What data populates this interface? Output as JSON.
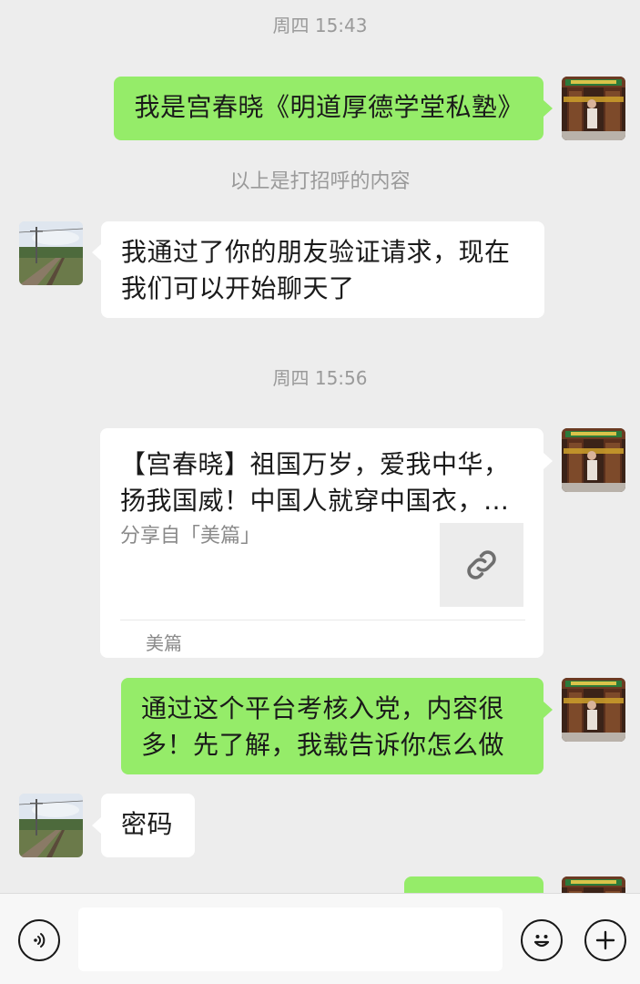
{
  "chat": {
    "messages": [
      {
        "type": "timestamp",
        "text": "周四 15:43"
      },
      {
        "type": "sent",
        "text": "我是宫春晓《明道厚德学堂私塾》",
        "avatar": "self-avatar-shop-photo"
      },
      {
        "type": "system",
        "text": "以上是打招呼的内容"
      },
      {
        "type": "received",
        "text": "我通过了你的朋友验证请求，现在我们可以开始聊天了",
        "avatar": "contact-avatar-railway-photo"
      },
      {
        "type": "timestamp",
        "text": "周四 15:56"
      },
      {
        "type": "sent_link",
        "title": "【宫春晓】祖国万岁，爱我中华，扬我国威！中国人就穿中国衣，…",
        "desc": "分享自「美篇」",
        "source": "美篇",
        "thumb_icon": "link-icon"
      },
      {
        "type": "sent",
        "text": "通过这个平台考核入党，内容很多！先了解，我载告诉你怎么做"
      },
      {
        "type": "received",
        "text": "密码"
      }
    ]
  },
  "input_bar": {
    "voice_icon": "voice-icon",
    "input_value": "",
    "emoji_icon": "emoji-icon",
    "more_icon": "plus-icon"
  },
  "colors": {
    "background": "#ededed",
    "sent_bubble": "#95ec69",
    "received_bubble": "#ffffff",
    "timestamp_text": "#9a9a9a"
  }
}
